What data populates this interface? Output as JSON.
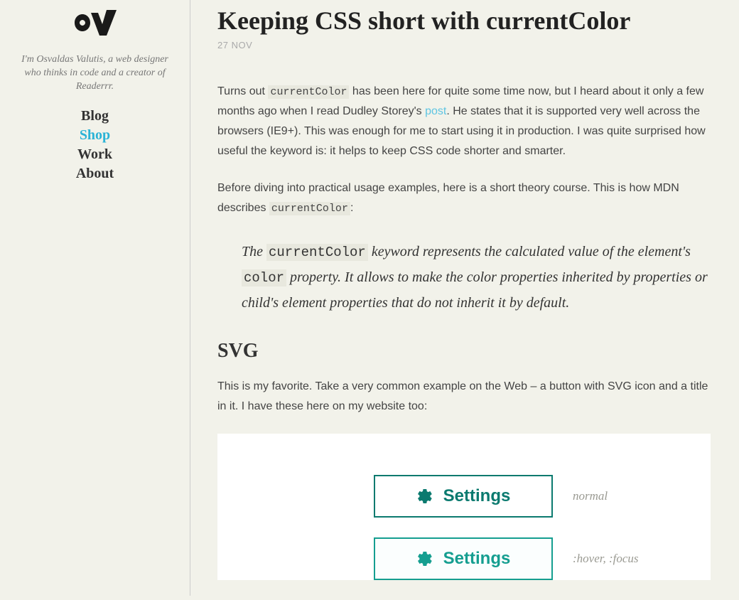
{
  "sidebar": {
    "tagline": "I'm Osvaldas Valutis, a web designer who thinks in code and a creator of Readerrr.",
    "nav": {
      "blog": "Blog",
      "shop": "Shop",
      "work": "Work",
      "about": "About"
    }
  },
  "article": {
    "title": "Keeping CSS short with currentColor",
    "date": "27 NOV",
    "p1_a": "Turns out ",
    "p1_code1": "currentColor",
    "p1_b": " has been here for quite some time now, but I heard about it only a few months ago when I read Dudley Storey's ",
    "p1_link": "post",
    "p1_c": ". He states that it is supported very well across the browsers (IE9+). This was enough for me to start using it in production. I was quite surprised how useful the keyword is: it helps to keep CSS code shorter and smarter.",
    "p2_a": "Before diving into practical usage examples, here is a short theory course. This is how MDN describes ",
    "p2_code1": "currentColor",
    "p2_b": ":",
    "quote_a": "The ",
    "quote_code1": "currentColor",
    "quote_b": " keyword represents the calculated value of the element's ",
    "quote_code2": "color",
    "quote_c": " property. It allows to make the color properties inherited by properties or child's element properties that do not inherit it by default.",
    "h2_svg": "SVG",
    "p3": "This is my favorite. Take a very common example on the Web – a button with SVG icon and a title in it. I have these here on my website too:",
    "demo": {
      "btn_label": "Settings",
      "state_normal": "normal",
      "state_hover": ":hover, :focus"
    }
  }
}
